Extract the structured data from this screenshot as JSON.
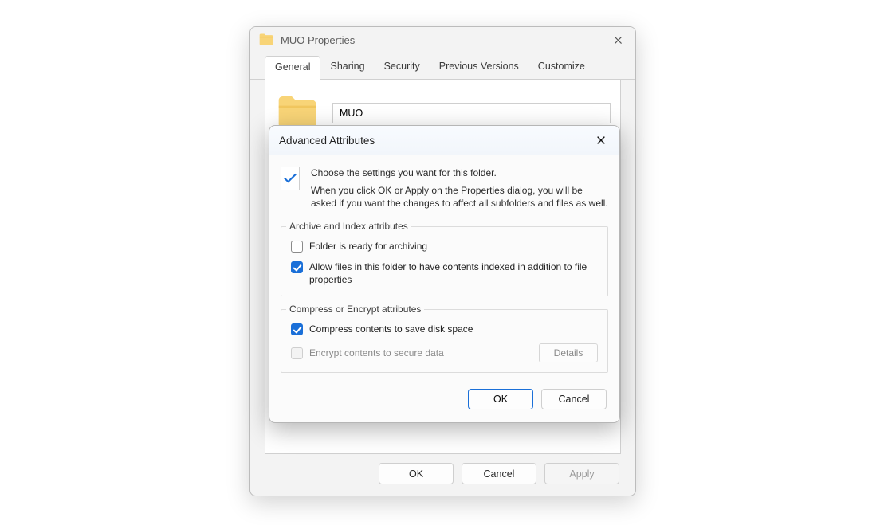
{
  "properties": {
    "title": "MUO Properties",
    "folder_name": "MUO",
    "tabs": {
      "general": "General",
      "sharing": "Sharing",
      "security": "Security",
      "previous": "Previous Versions",
      "customize": "Customize"
    },
    "buttons": {
      "ok": "OK",
      "cancel": "Cancel",
      "apply": "Apply"
    }
  },
  "advanced": {
    "title": "Advanced Attributes",
    "intro1": "Choose the settings you want for this folder.",
    "intro2": "When you click OK or Apply on the Properties dialog, you will be asked if you want the changes to affect all subfolders and files as well.",
    "groups": {
      "archive": {
        "legend": "Archive and Index attributes",
        "archiving_label": "Folder is ready for archiving",
        "archiving_checked": false,
        "index_label": "Allow files in this folder to have contents indexed in addition to file properties",
        "index_checked": true
      },
      "compress": {
        "legend": "Compress or Encrypt attributes",
        "compress_label": "Compress contents to save disk space",
        "compress_checked": true,
        "encrypt_label": "Encrypt contents to secure data",
        "encrypt_disabled": true,
        "details_label": "Details"
      }
    },
    "buttons": {
      "ok": "OK",
      "cancel": "Cancel"
    }
  }
}
